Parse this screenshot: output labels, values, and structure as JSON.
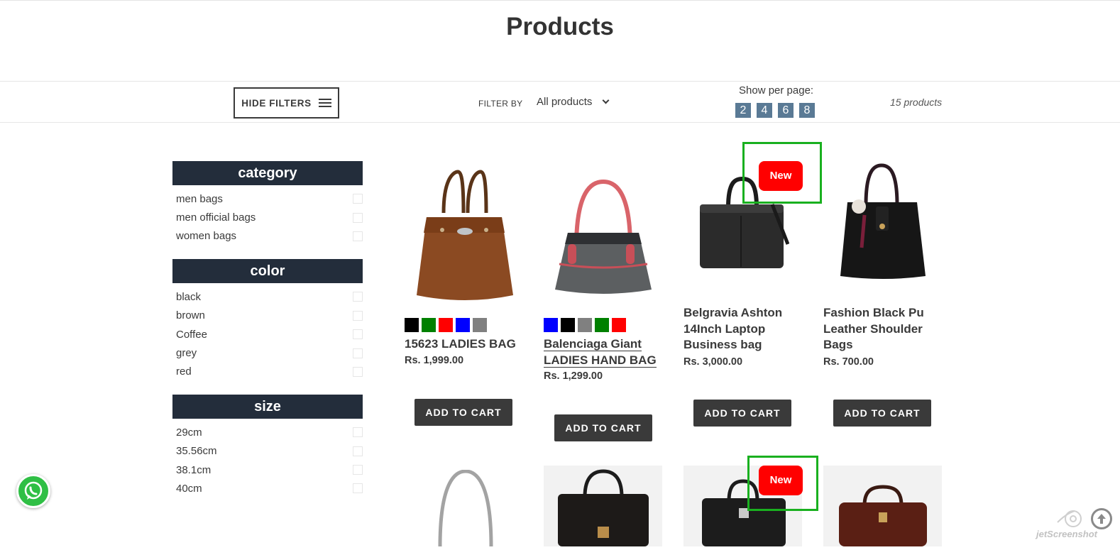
{
  "page": {
    "title": "Products"
  },
  "toolbar": {
    "hide_filters_label": "HIDE FILTERS",
    "filter_by_label": "FILTER BY",
    "filter_selected": "All products",
    "per_page_label": "Show per page:",
    "per_page_options": [
      "2",
      "4",
      "6",
      "8"
    ],
    "product_count": "15 products"
  },
  "filters": [
    {
      "heading": "category",
      "items": [
        "men bags",
        "men official bags",
        "women bags"
      ]
    },
    {
      "heading": "color",
      "items": [
        "black",
        "brown",
        "Coffee",
        "grey",
        "red"
      ]
    },
    {
      "heading": "size",
      "items": [
        "29cm",
        "35.56cm",
        "38.1cm",
        "40cm"
      ]
    }
  ],
  "products": [
    {
      "title": "15623 LADIES BAG",
      "price": "Rs. 1,999.00",
      "cta": "ADD TO CART",
      "swatches": [
        "#000000",
        "#008000",
        "#ff0000",
        "#0000ff",
        "#808080"
      ]
    },
    {
      "title": "Balenciaga Giant LADIES HAND BAG",
      "price": "Rs. 1,299.00",
      "cta": "ADD TO CART",
      "swatches": [
        "#0000ff",
        "#000000",
        "#808080",
        "#008000",
        "#ff0000"
      ]
    },
    {
      "title": "Belgravia Ashton 14Inch Laptop Business bag",
      "price": "Rs. 3,000.00",
      "cta": "ADD TO CART",
      "badge": "New"
    },
    {
      "title": "Fashion Black Pu Leather Shoulder Bags",
      "price": "Rs. 700.00",
      "cta": "ADD TO CART"
    }
  ],
  "second_row_badge": "New",
  "watermark": "jetScreenshot",
  "colors": {
    "header_bg": "#232d3b",
    "accent_btn": "#3a3a3a",
    "per_page_btn": "#5a7a95",
    "badge": "#ff0000",
    "highlight": "#19b01f"
  }
}
